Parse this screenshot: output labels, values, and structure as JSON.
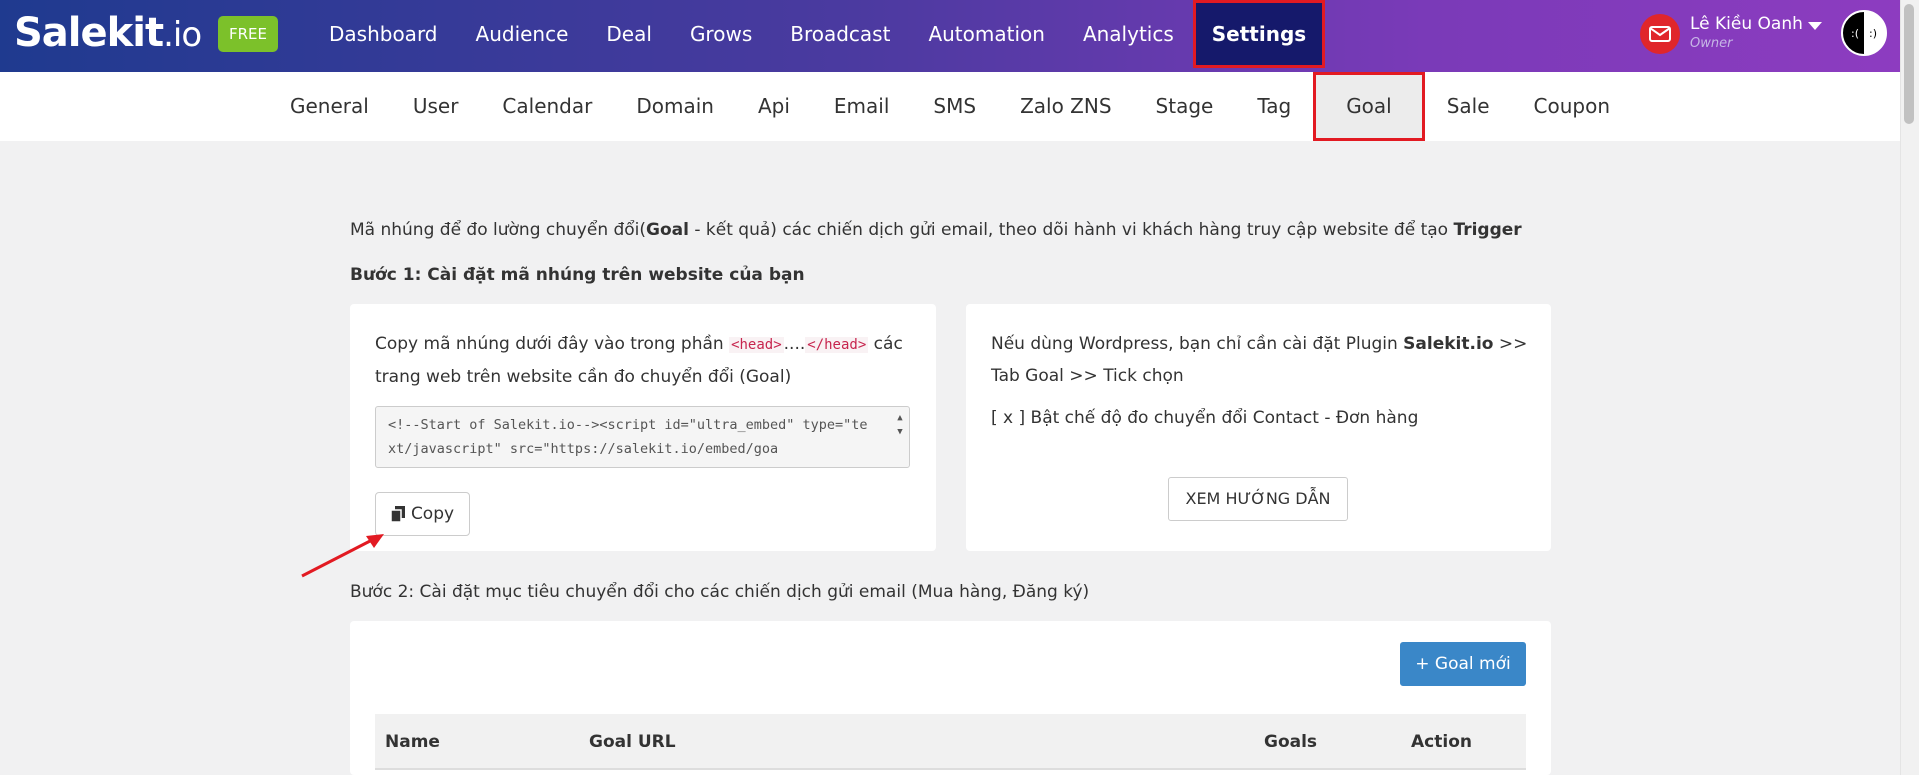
{
  "brand": {
    "name": "Salekit",
    "suffix": ".io",
    "badge": "FREE"
  },
  "nav": [
    {
      "label": "Dashboard"
    },
    {
      "label": "Audience"
    },
    {
      "label": "Deal"
    },
    {
      "label": "Grows"
    },
    {
      "label": "Broadcast"
    },
    {
      "label": "Automation"
    },
    {
      "label": "Analytics"
    },
    {
      "label": "Settings",
      "active": true
    }
  ],
  "user": {
    "name": "Lê Kiều Oanh",
    "role": "Owner",
    "avatar_left": ":(",
    "avatar_right": ":)"
  },
  "subnav": [
    {
      "label": "General"
    },
    {
      "label": "User"
    },
    {
      "label": "Calendar"
    },
    {
      "label": "Domain"
    },
    {
      "label": "Api"
    },
    {
      "label": "Email"
    },
    {
      "label": "SMS"
    },
    {
      "label": "Zalo ZNS"
    },
    {
      "label": "Stage"
    },
    {
      "label": "Tag"
    },
    {
      "label": "Goal",
      "active": true
    },
    {
      "label": "Sale"
    },
    {
      "label": "Coupon"
    }
  ],
  "intro": {
    "part1": "Mã nhúng để đo lường chuyển đổi(",
    "goal": "Goal",
    "part2": " - kết quả) các chiến dịch gửi email, theo dõi hành vi khách hàng truy cập website để tạo ",
    "trigger": "Trigger"
  },
  "step1": "Bước 1: Cài đặt mã nhúng trên website của bạn",
  "left_card": {
    "text_before": "Copy mã nhúng dưới đây vào trong phần ",
    "head_open": "<head>",
    "dots": "....",
    "head_close": "</head>",
    "text_after": " các trang web trên website cần đo chuyển đổi (Goal)",
    "code": "<!--Start of Salekit.io--><script id=\"ultra_embed\" type=\"text/javascript\" src=\"https://salekit.io/embed/goa",
    "copy_label": "Copy"
  },
  "right_card": {
    "line1_before": "Nếu dùng Wordpress, bạn chỉ cần cài đặt Plugin ",
    "plugin": "Salekit.io",
    "line1_after": " >> Tab Goal >> Tick chọn",
    "line2": "[ x ] Bật chế độ đo chuyển đổi Contact - Đơn hàng",
    "guide_label": "XEM HƯỚNG DẪN"
  },
  "step2": "Bước 2: Cài đặt mục tiêu chuyển đổi cho các chiến dịch gửi email (Mua hàng, Đăng ký)",
  "goals": {
    "new_button": "Goal mới",
    "columns": [
      "Name",
      "Goal URL",
      "Goals",
      "Action"
    ]
  },
  "colors": {
    "accent": "#e21a22",
    "primary": "#3a87c8",
    "badge": "#7cc12a"
  }
}
